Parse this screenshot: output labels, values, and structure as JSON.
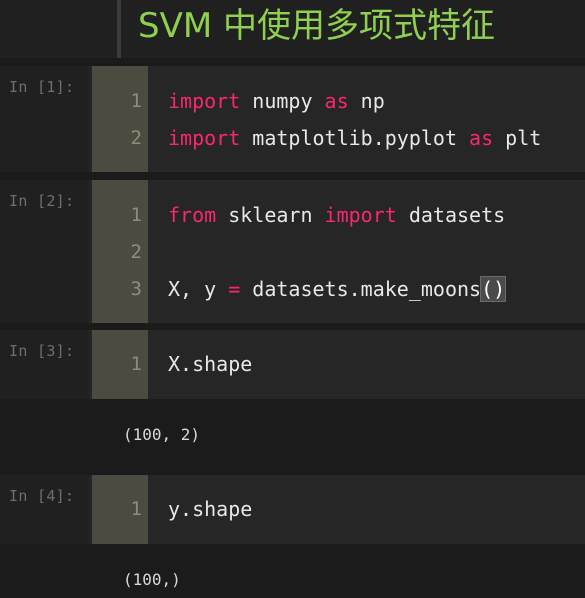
{
  "heading": "SVM 中使用多项式特征",
  "cells": [
    {
      "prompt": "In [1]:",
      "lines": [
        {
          "no": "1",
          "tokens": [
            [
              "kw",
              "import"
            ],
            [
              "t",
              " numpy "
            ],
            [
              "kw",
              "as"
            ],
            [
              "t",
              " np"
            ]
          ]
        },
        {
          "no": "2",
          "tokens": [
            [
              "kw",
              "import"
            ],
            [
              "t",
              " matplotlib.pyplot "
            ],
            [
              "kw",
              "as"
            ],
            [
              "t",
              " plt"
            ]
          ]
        }
      ]
    },
    {
      "prompt": "In [2]:",
      "lines": [
        {
          "no": "1",
          "tokens": [
            [
              "kw",
              "from"
            ],
            [
              "t",
              " sklearn "
            ],
            [
              "kw",
              "import"
            ],
            [
              "t",
              " datasets"
            ]
          ]
        },
        {
          "no": "2",
          "tokens": []
        },
        {
          "no": "3",
          "tokens": [
            [
              "t",
              "X, y "
            ],
            [
              "op",
              "="
            ],
            [
              "t",
              " datasets.make_moons"
            ],
            [
              "paren",
              "()"
            ]
          ]
        }
      ]
    },
    {
      "prompt": "In [3]:",
      "lines": [
        {
          "no": "1",
          "tokens": [
            [
              "t",
              "X.shape"
            ]
          ]
        }
      ],
      "output": "(100, 2)"
    },
    {
      "prompt": "In [4]:",
      "lines": [
        {
          "no": "1",
          "tokens": [
            [
              "t",
              "y.shape"
            ]
          ]
        }
      ],
      "output": "(100,)"
    }
  ]
}
